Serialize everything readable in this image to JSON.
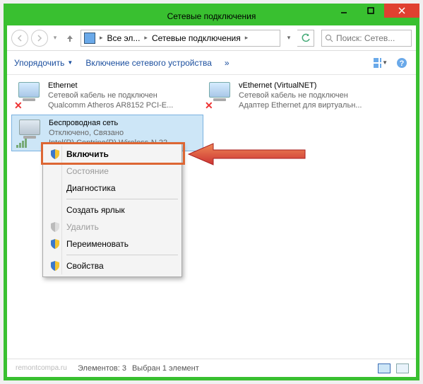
{
  "window": {
    "title": "Сетевые подключения"
  },
  "breadcrumb": {
    "item1": "Все эл...",
    "item2": "Сетевые подключения"
  },
  "search": {
    "placeholder": "Поиск: Сетев..."
  },
  "cmdbar": {
    "organize": "Упорядочить",
    "enable_device": "Включение сетевого устройства",
    "chevron": "»"
  },
  "adapters": [
    {
      "name": "Ethernet",
      "status": "Сетевой кабель не подключен",
      "driver": "Qualcomm Atheros AR8152 PCI-E...",
      "error": true
    },
    {
      "name": "vEthernet (VirtualNET)",
      "status": "Сетевой кабель не подключен",
      "driver": "Адаптер Ethernet для виртуальн...",
      "error": true
    },
    {
      "name": "Беспроводная сеть",
      "status": "Отключено, Связано",
      "driver": "Intel(R) Centrino(R) Wireless-N 22...",
      "error": false,
      "selected": true
    }
  ],
  "context_menu": {
    "enable": "Включить",
    "status": "Состояние",
    "diagnose": "Диагностика",
    "shortcut": "Создать ярлык",
    "delete": "Удалить",
    "rename": "Переименовать",
    "properties": "Свойства"
  },
  "statusbar": {
    "count_label": "Элементов: 3",
    "selected_label": "Выбран 1 элемент"
  },
  "watermark": "remontcompa.ru"
}
